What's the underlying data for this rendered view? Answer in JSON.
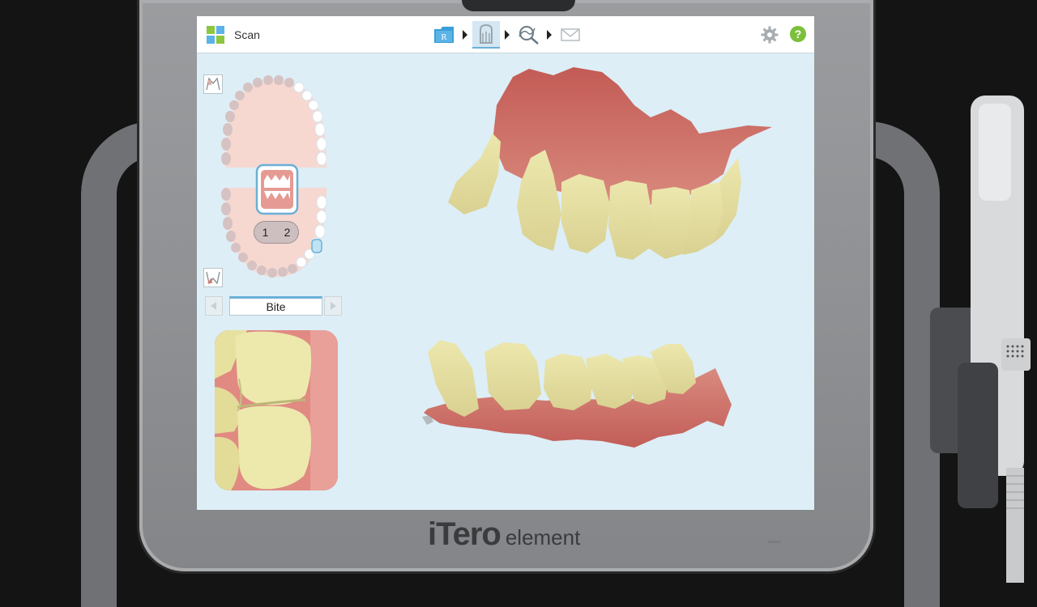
{
  "device": {
    "brand_main": "iTero",
    "brand_sub": "element"
  },
  "topbar": {
    "title": "Scan",
    "app_icon_colors": [
      "#8dc63f",
      "#5bb3e6",
      "#5bb3e6",
      "#8dc63f"
    ],
    "workflow_steps": [
      {
        "icon": "rx-folder-icon",
        "label": "R",
        "active": false
      },
      {
        "icon": "scan-tooth-icon",
        "active": true
      },
      {
        "icon": "view-inspect-icon",
        "active": false
      },
      {
        "icon": "send-envelope-icon",
        "active": false
      }
    ],
    "settings_icon": "gear-icon",
    "help_label": "?"
  },
  "jaw_map": {
    "bite_segments": [
      "1",
      "2"
    ]
  },
  "segment_nav": {
    "current": "Bite"
  },
  "colors": {
    "screen_bg": "#ddeef6",
    "gum": "#c9645e",
    "tooth": "#e9e3a6",
    "accent": "#6ab0d8",
    "help": "#7bbf3b"
  }
}
